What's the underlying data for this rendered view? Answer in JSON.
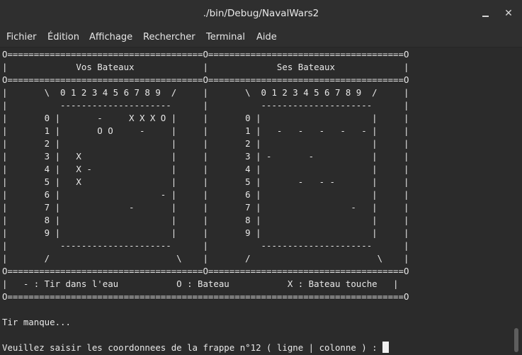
{
  "window": {
    "title": "./bin/Debug/NavalWars2",
    "minimize_icon": "minimize-icon",
    "close_label": "✕"
  },
  "menu": [
    "Fichier",
    "Édition",
    "Affichage",
    "Rechercher",
    "Terminal",
    "Aide"
  ],
  "terminal": {
    "lines": [
      "O=====================================O=====================================O",
      "|             Vos Bateaux             |             Ses Bateaux             |",
      "O=====================================O=====================================O",
      "|       \\  0 1 2 3 4 5 6 7 8 9  /     |       \\  0 1 2 3 4 5 6 7 8 9  /     |",
      "|          ---------------------      |          ---------------------      |",
      "|       0 |       -     X X X O |     |       0 |                     |     |",
      "|       1 |       O O     -     |     |       1 |   -   -   -   -   - |     |",
      "|       2 |                     |     |       2 |                     |     |",
      "|       3 |   X                 |     |       3 | -       -           |     |",
      "|       4 |   X -               |     |       4 |                     |     |",
      "|       5 |   X                 |     |       5 |       -   - -       |     |",
      "|       6 |                   - |     |       6 |                     |     |",
      "|       7 |             -       |     |       7 |                 -   |     |",
      "|       8 |                     |     |       8 |                     |     |",
      "|       9 |                     |     |       9 |                     |     |",
      "|          ---------------------      |          ---------------------      |",
      "|       /                        \\    |       /                        \\    |",
      "O=====================================O=====================================O",
      "|   - : Tir dans l'eau           O : Bateau           X : Bateau touche   |",
      "O===========================================================================O",
      "",
      "Tir manque...",
      "",
      "Veuillez saisir les coordonnees de la frappe n°12 ( ligne | colonne ) : "
    ]
  }
}
